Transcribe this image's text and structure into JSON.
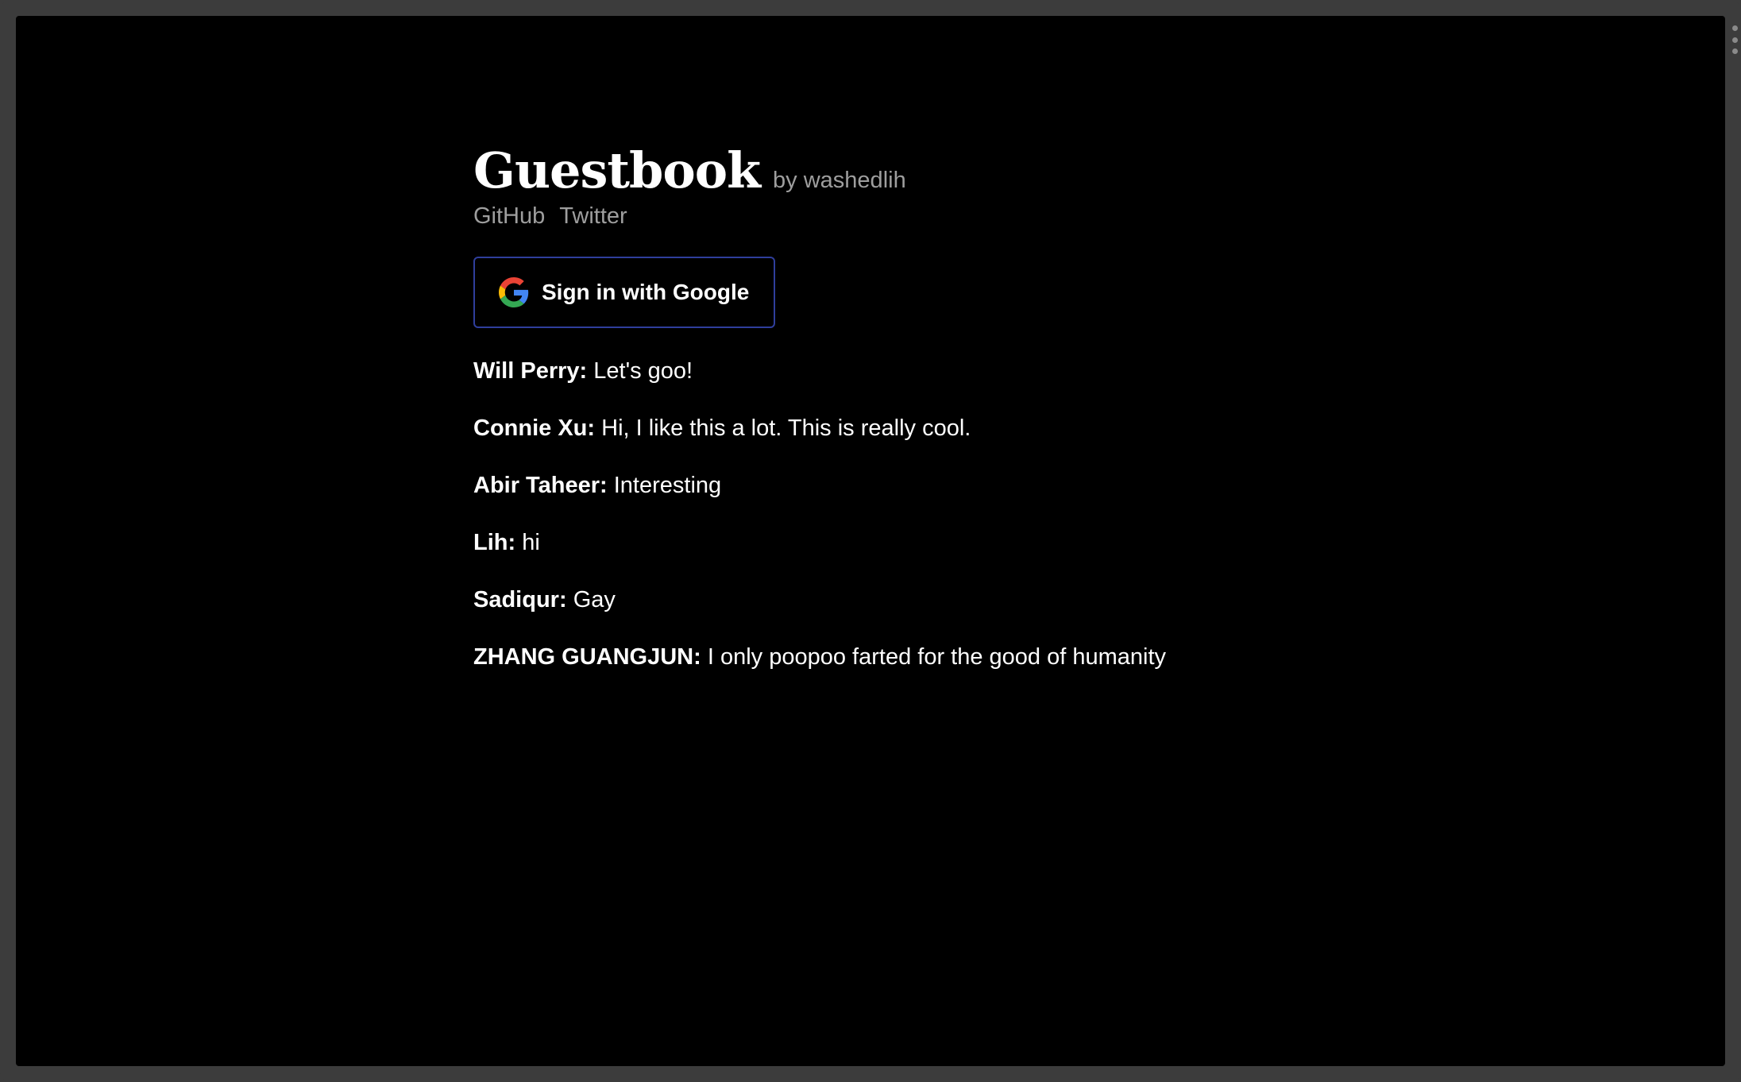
{
  "header": {
    "title": "Guestbook",
    "byline": "by washedlih",
    "links": [
      {
        "label": "GitHub"
      },
      {
        "label": "Twitter"
      }
    ]
  },
  "auth": {
    "sign_in_label": "Sign in with Google",
    "icon": "google-icon"
  },
  "entries": [
    {
      "author": "Will Perry",
      "message": "Let's goo!"
    },
    {
      "author": "Connie Xu",
      "message": "Hi, I like this a lot. This is really cool."
    },
    {
      "author": "Abir Taheer",
      "message": "Interesting"
    },
    {
      "author": "Lih",
      "message": "hi"
    },
    {
      "author": "Sadiqur",
      "message": "Gay"
    },
    {
      "author": "ZHANG GUANGJUN",
      "message": "I only poopoo farted for the good of humanity"
    }
  ],
  "colors": {
    "background": "#000000",
    "frame": "#3c3c3c",
    "muted_text": "#9e9e9e",
    "button_border": "#2f3e9c",
    "text": "#ffffff"
  }
}
